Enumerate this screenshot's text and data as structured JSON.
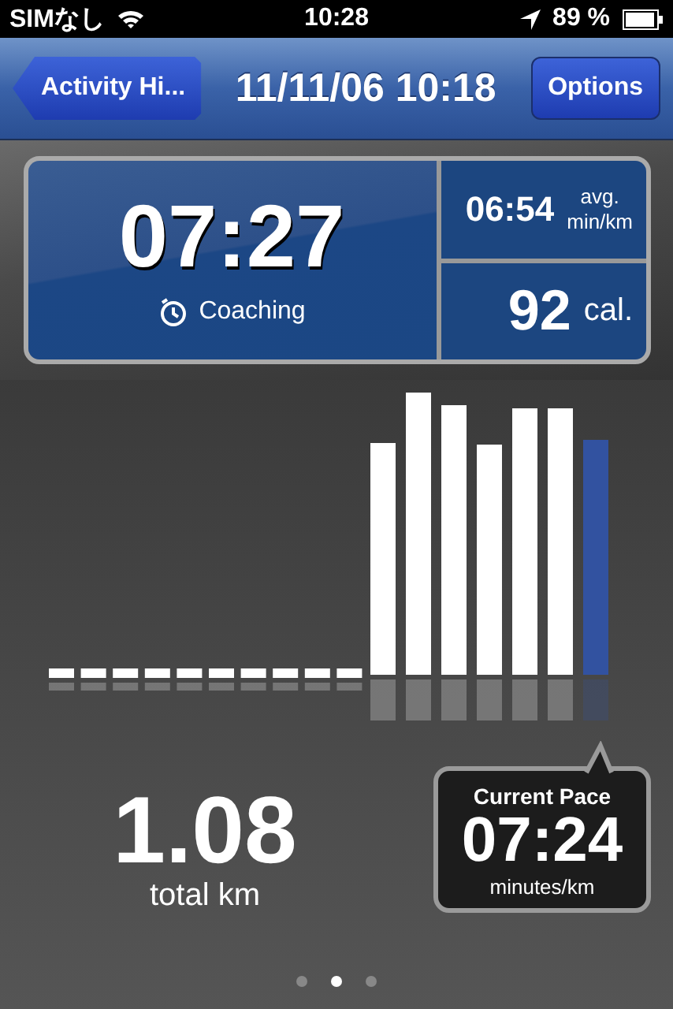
{
  "status_bar": {
    "carrier": "SIMなし",
    "time": "10:28",
    "battery": "89 %"
  },
  "nav_bar": {
    "back": "Activity Hi...",
    "title": "11/11/06 10:18",
    "action": "Options"
  },
  "summary": {
    "duration": "07:27",
    "mode": "Coaching",
    "avg_pace": "06:54",
    "avg_label": "avg.",
    "avg_unit": "min/km",
    "calories": "92",
    "calories_unit": "cal."
  },
  "distance": {
    "value": "1.08",
    "unit": "total km"
  },
  "current_pace": {
    "title": "Current Pace",
    "value": "07:24",
    "unit": "minutes/km"
  },
  "pages": [
    {
      "selected": false
    },
    {
      "selected": true
    },
    {
      "selected": false
    }
  ]
}
